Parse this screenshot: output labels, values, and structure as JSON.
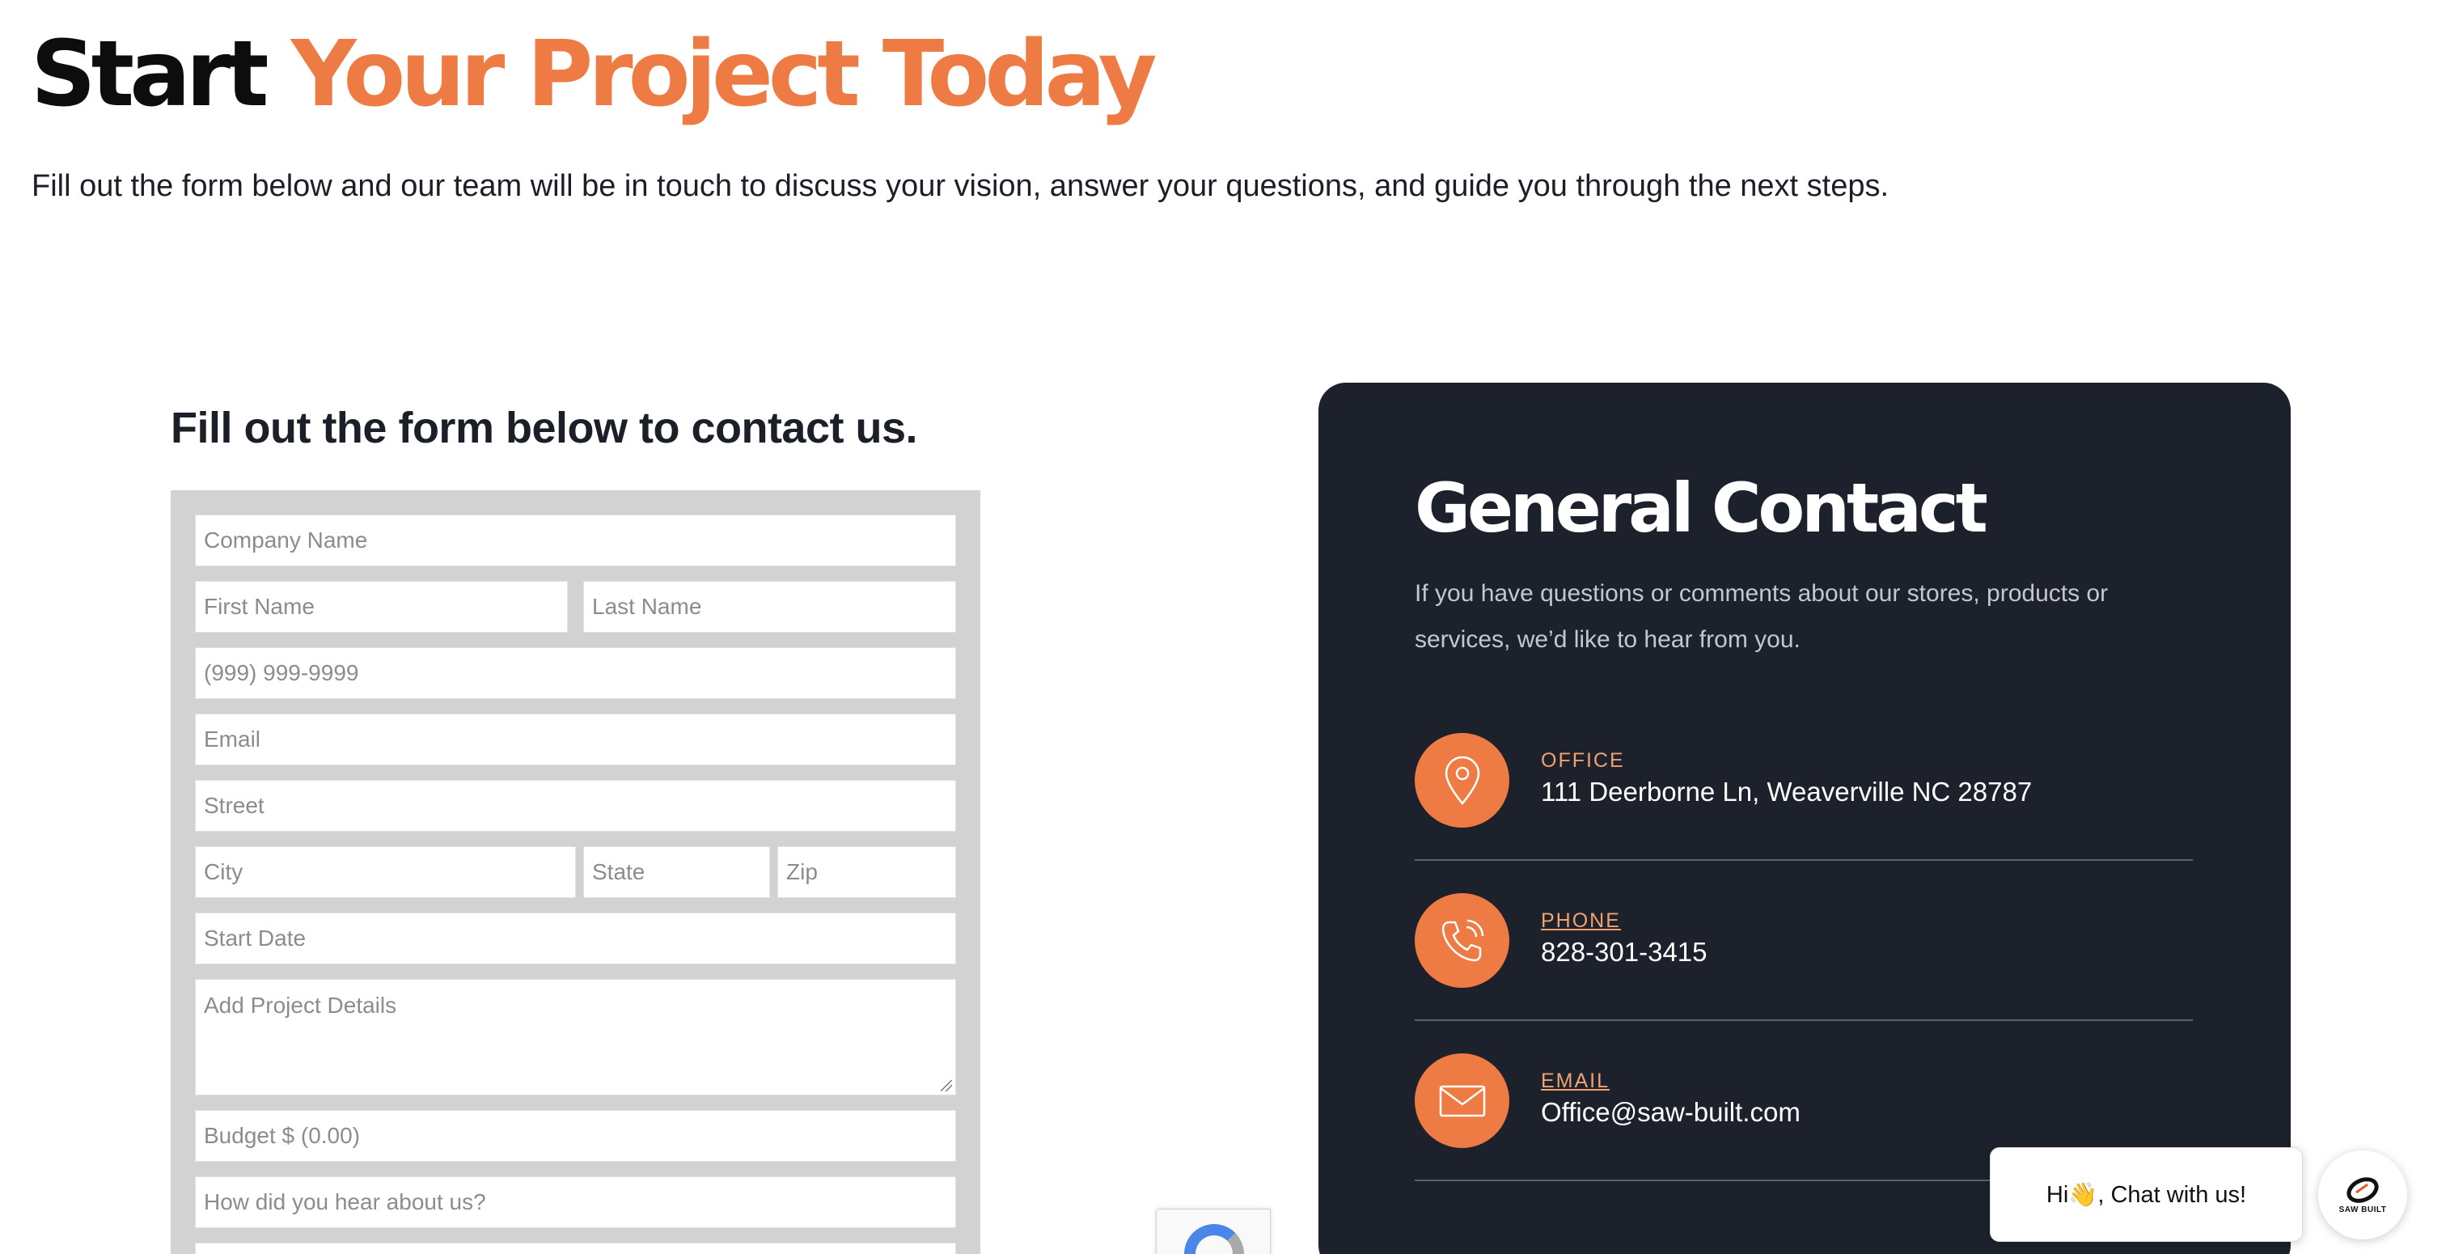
{
  "hero": {
    "title_part1": "Start",
    "title_part2": "Your Project Today",
    "subtitle": "Fill out the form below and our team will be in touch to discuss your vision, answer your questions, and guide you through the next steps."
  },
  "form": {
    "heading": "Fill out the form below to contact us.",
    "company_placeholder": "Company Name",
    "first_name_placeholder": "First Name",
    "last_name_placeholder": "Last Name",
    "phone_placeholder": "(999) 999-9999",
    "email_placeholder": "Email",
    "street_placeholder": "Street",
    "city_placeholder": "City",
    "state_placeholder": "State",
    "zip_placeholder": "Zip",
    "start_date_placeholder": "Start Date",
    "details_placeholder": "Add Project Details",
    "budget_placeholder": "Budget $ (0.00)",
    "referral_placeholder": "How did you hear about us?"
  },
  "contact": {
    "title": "General Contact",
    "subtitle": "If you have questions or comments about our stores, products or services, we’d like to hear from you.",
    "office_label": "OFFICE",
    "office_value": "111 Deerborne Ln, Weaverville NC 28787",
    "phone_label": "PHONE",
    "phone_value": "828-301-3415",
    "email_label": "EMAIL",
    "email_value": "Office@saw-built.com"
  },
  "chat": {
    "bubble_text": "Hi👋, Chat with us!",
    "brand_text": "SAW BUILT"
  },
  "colors": {
    "accent": "#ee7b43",
    "card_bg": "#1c212b",
    "form_bg": "#d2d2d2"
  },
  "icons": [
    "map-pin-icon",
    "phone-icon",
    "mail-icon",
    "recaptcha-icon",
    "brand-logo-icon"
  ]
}
